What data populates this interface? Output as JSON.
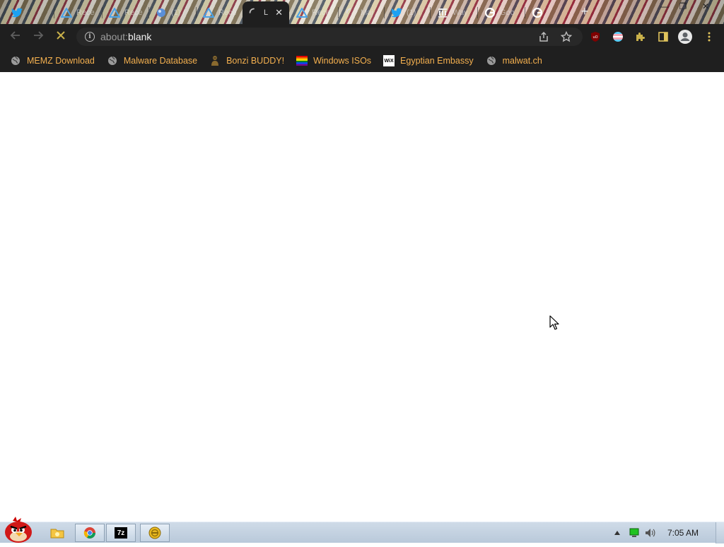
{
  "browser": {
    "tabs": [
      {
        "title": "Twitter",
        "icon": "twitter-icon",
        "active": false
      },
      {
        "title": "Rece",
        "icon": "triangle-logo-icon",
        "active": false
      },
      {
        "title": "Rece",
        "icon": "triangle-logo-icon",
        "active": false
      },
      {
        "title": "(1) /",
        "icon": "globe-icon",
        "active": false
      },
      {
        "title": "Rece",
        "icon": "triangle-logo-icon",
        "active": false
      },
      {
        "title": "L",
        "icon": "loading-spinner-icon",
        "active": true
      },
      {
        "title": "Rece",
        "icon": "triangle-logo-icon",
        "active": false
      },
      {
        "title": "Maj",
        "icon": "loading-spinner-icon",
        "active": false
      },
      {
        "title": "(1) I",
        "icon": "twitter-icon",
        "active": false
      },
      {
        "title": "Way",
        "icon": "archive-icon",
        "active": false
      },
      {
        "title": "Goo",
        "icon": "google-icon",
        "active": false
      },
      {
        "title": "",
        "icon": "google-icon",
        "active": false
      }
    ],
    "active_tab_close": "✕",
    "new_tab": "+",
    "window_controls": {
      "minimize": "—",
      "restore": "❐",
      "close": "✕"
    },
    "address": {
      "scheme": "about:",
      "rest": "blank"
    },
    "bookmarks": [
      {
        "label": "MEMZ Download",
        "icon": "globe-icon"
      },
      {
        "label": "Malware Database",
        "icon": "globe-icon"
      },
      {
        "label": "Bonzi BUDDY!",
        "icon": "bonzi-icon"
      },
      {
        "label": "Windows ISOs",
        "icon": "rainbow-flag-icon"
      },
      {
        "label": "Egyptian Embassy",
        "icon": "wix-icon"
      },
      {
        "label": "malwat.ch",
        "icon": "globe-icon"
      }
    ],
    "wix_text": "WiX"
  },
  "taskbar": {
    "clock": "7:05 AM",
    "apps": [
      "explorer-icon",
      "chrome-icon",
      "7zip-icon",
      "bonzi-app-icon"
    ],
    "seven_zip_label": "7z"
  },
  "colors": {
    "bookmark_text": "#f4b04f",
    "toolbar_bg": "#1f1f1f",
    "accent": "#c8b04a"
  }
}
